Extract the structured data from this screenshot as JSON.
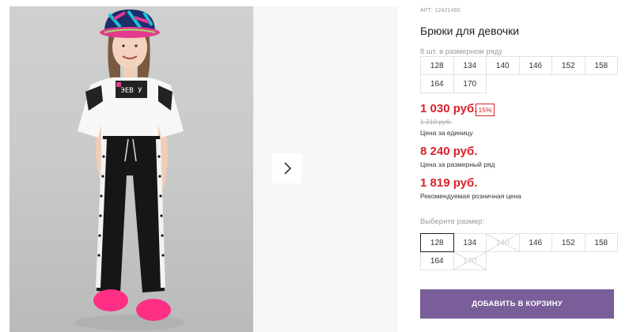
{
  "product": {
    "art": "АРТ: 12421480",
    "title": "Брюки для девочки"
  },
  "size_range": {
    "caption": "8 шт. в размерном ряду",
    "sizes": [
      "128",
      "134",
      "140",
      "146",
      "152",
      "158",
      "164",
      "170"
    ]
  },
  "pricing": {
    "unit_price": "1 030 руб.",
    "discount": "15%",
    "old_price": "1 210 руб.",
    "unit_caption": "Цена за единицу",
    "range_price": "8 240 руб.",
    "range_caption": "Цена за размерный ряд",
    "retail_price": "1 819 руб.",
    "retail_caption": "Рекомендуемая розничная цена"
  },
  "size_select": {
    "caption": "Выберите размер:",
    "options": [
      {
        "label": "128",
        "state": "selected"
      },
      {
        "label": "134",
        "state": "available"
      },
      {
        "label": "140",
        "state": "disabled"
      },
      {
        "label": "146",
        "state": "available"
      },
      {
        "label": "152",
        "state": "available"
      },
      {
        "label": "158",
        "state": "available"
      },
      {
        "label": "164",
        "state": "available"
      },
      {
        "label": "170",
        "state": "disabled"
      }
    ]
  },
  "cart": {
    "add_label": "ДОБАВИТЬ В КОРЗИНУ"
  },
  "gallery": {
    "next_icon": "chevron-right-icon",
    "photo_print_text": "ЭЕВ У"
  },
  "colors": {
    "accent": "#7a5e99",
    "price_red": "#d8232a"
  }
}
